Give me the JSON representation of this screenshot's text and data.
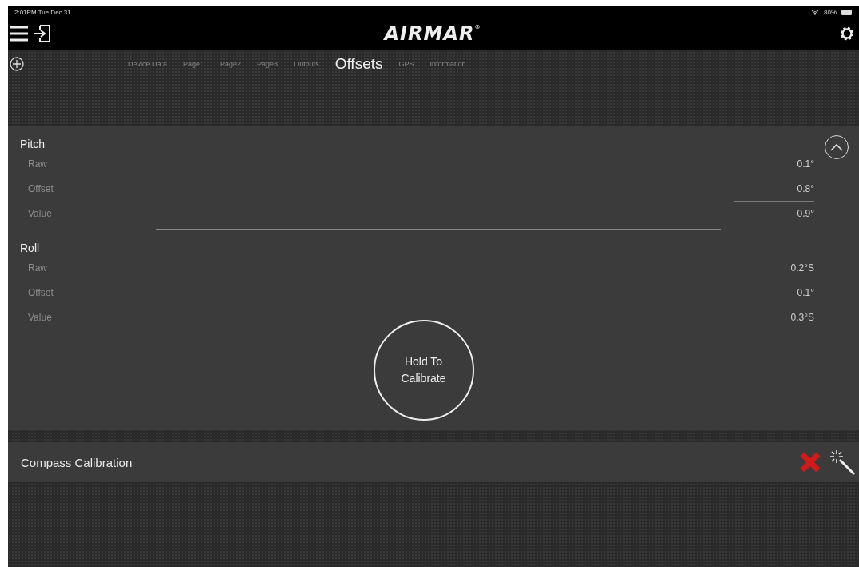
{
  "status_bar": {
    "time": "2:01PM  Tue Dec 31",
    "battery": "80%"
  },
  "header": {
    "logo": "AIRMAR",
    "logo_mark": "®"
  },
  "tabs": [
    {
      "label": "Device Data",
      "selected": false
    },
    {
      "label": "Page1",
      "selected": false
    },
    {
      "label": "Page2",
      "selected": false
    },
    {
      "label": "Page3",
      "selected": false
    },
    {
      "label": "Outputs",
      "selected": false
    },
    {
      "label": "Offsets",
      "selected": true
    },
    {
      "label": "GPS",
      "selected": false
    },
    {
      "label": "Information",
      "selected": false
    }
  ],
  "sections": [
    {
      "title": "Pitch",
      "rows": [
        {
          "label": "Raw",
          "value": "0.1°"
        },
        {
          "label": "Offset",
          "value": "0.8°"
        },
        {
          "label": "Value",
          "value": "0.9°"
        }
      ]
    },
    {
      "title": "Roll",
      "rows": [
        {
          "label": "Raw",
          "value": "0.2°S"
        },
        {
          "label": "Offset",
          "value": "0.1°"
        },
        {
          "label": "Value",
          "value": "0.3°S"
        }
      ]
    }
  ],
  "calibrate_button": {
    "line_1": "Hold To",
    "line_2": "Calibrate"
  },
  "compass": {
    "label": "Compass Calibration",
    "calibrated": false
  }
}
